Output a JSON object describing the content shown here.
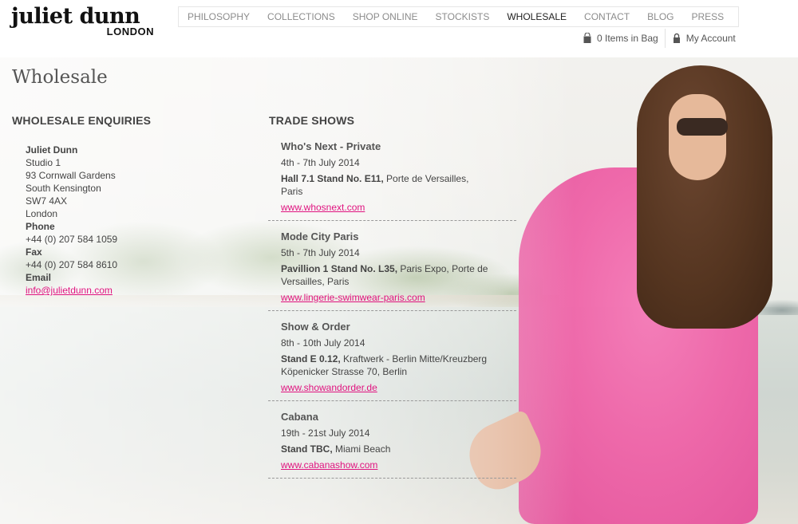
{
  "brand": {
    "name": "juliet dunn",
    "city": "LONDON"
  },
  "nav": [
    {
      "label": "PHILOSOPHY",
      "active": false
    },
    {
      "label": "COLLECTIONS",
      "active": false
    },
    {
      "label": "SHOP ONLINE",
      "active": false
    },
    {
      "label": "STOCKISTS",
      "active": false
    },
    {
      "label": "WHOLESALE",
      "active": true
    },
    {
      "label": "CONTACT",
      "active": false
    },
    {
      "label": "BLOG",
      "active": false
    },
    {
      "label": "PRESS",
      "active": false
    }
  ],
  "utility": {
    "bag_label": "0 Items in Bag",
    "bag_icon": "shopping-bag-icon",
    "account_label": "My Account",
    "account_icon": "lock-icon"
  },
  "page": {
    "title": "Wholesale"
  },
  "enquiries": {
    "heading": "WHOLESALE ENQUIRIES",
    "name": "Juliet Dunn",
    "address_lines": [
      "Studio 1",
      "93 Cornwall Gardens",
      "South Kensington",
      "SW7 4AX",
      "London"
    ],
    "phone_label": "Phone",
    "phone": "+44 (0) 207 584 1059",
    "fax_label": "Fax",
    "fax": "+44 (0) 207 584 8610",
    "email_label": "Email",
    "email": "info@julietdunn.com"
  },
  "trade_shows": {
    "heading": "TRADE SHOWS",
    "shows": [
      {
        "name": "Who's Next - Private",
        "dates": "4th - 7th July 2014",
        "venue_bold": "Hall 7.1 Stand No. E11,",
        "venue_rest": " Porte de Versailles, Paris",
        "link": "www.whosnext.com"
      },
      {
        "name": "Mode City Paris",
        "dates": "5th - 7th July 2014",
        "venue_bold": "Pavillion 1 Stand No. L35,",
        "venue_rest": " Paris Expo, Porte de Versailles, Paris",
        "link": "www.lingerie-swimwear-paris.com"
      },
      {
        "name": "Show & Order",
        "dates": "8th - 10th July 2014",
        "venue_bold": "Stand E 0.12,",
        "venue_rest": " Kraftwerk - Berlin Mitte/Kreuzberg Köpenicker Strasse 70, Berlin",
        "link": "www.showandorder.de"
      },
      {
        "name": "Cabana",
        "dates": "19th - 21st July 2014",
        "venue_bold": "Stand TBC,",
        "venue_rest": " Miami Beach",
        "link": "www.cabanashow.com"
      }
    ]
  },
  "colors": {
    "link": "#e0137f",
    "dress": "#ef64a8",
    "text": "#444444"
  }
}
